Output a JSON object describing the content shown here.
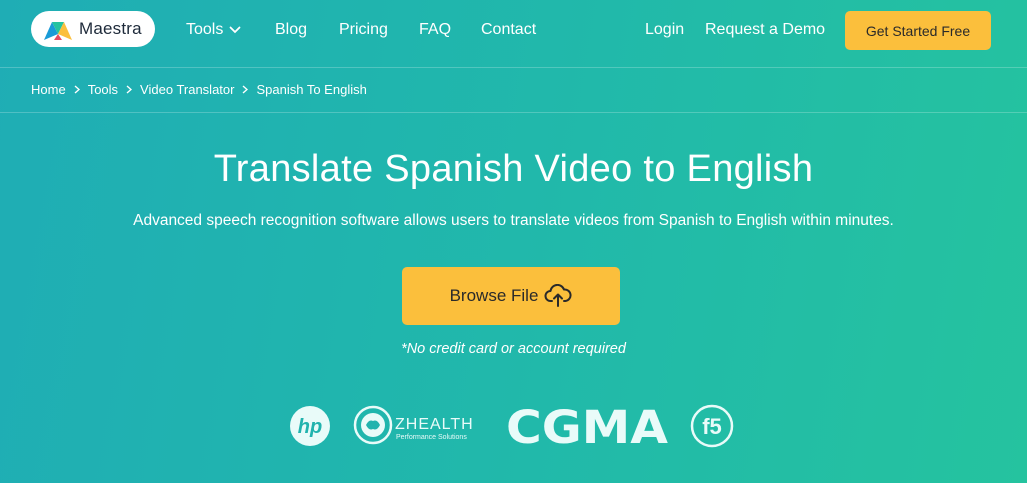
{
  "nav": {
    "logo_text": "Maestra",
    "links": {
      "tools": "Tools",
      "blog": "Blog",
      "pricing": "Pricing",
      "faq": "FAQ",
      "contact": "Contact",
      "login": "Login",
      "demo": "Request a Demo"
    },
    "cta_label": "Get Started Free"
  },
  "breadcrumb": {
    "items": [
      "Home",
      "Tools",
      "Video Translator",
      "Spanish To English"
    ]
  },
  "hero": {
    "title": "Translate Spanish Video to English",
    "subtitle": "Advanced speech recognition software allows users to translate videos from Spanish to English within minutes.",
    "browse_label": "Browse File",
    "note": "*No credit card or account required"
  },
  "brands": {
    "hp": "hp",
    "zhealth_name": "ZHEALTH",
    "zhealth_tagline": "Performance Solutions",
    "cgma": "CGMA",
    "f5": "f5"
  },
  "colors": {
    "accent": "#fbbf3c",
    "background_start": "#1fadb5",
    "background_end": "#25c39f"
  }
}
